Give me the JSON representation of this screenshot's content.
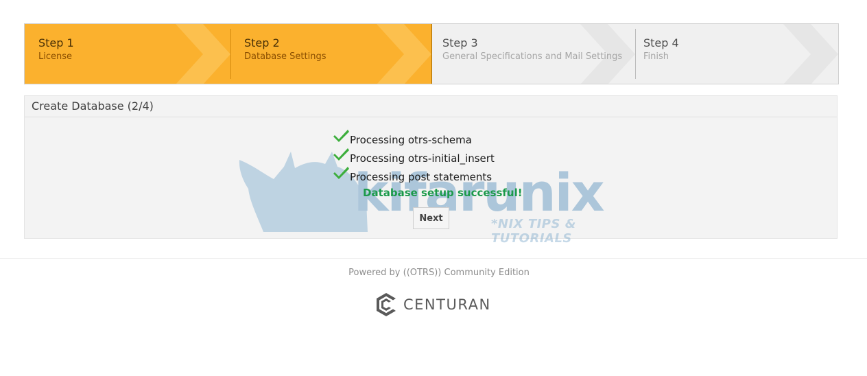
{
  "steps": [
    {
      "title": "Step 1",
      "subtitle": "License",
      "state": "completed"
    },
    {
      "title": "Step 2",
      "subtitle": "Database Settings",
      "state": "active"
    },
    {
      "title": "Step 3",
      "subtitle": "General Specifications and Mail Settings",
      "state": "pending"
    },
    {
      "title": "Step 4",
      "subtitle": "Finish",
      "state": "pending"
    }
  ],
  "panel": {
    "title": "Create Database (2/4)",
    "items": [
      {
        "text": "Processing otrs-schema",
        "icon": "check-icon"
      },
      {
        "text": "Processing otrs-initial_insert",
        "icon": "check-icon"
      },
      {
        "text": "Processing post statements",
        "icon": "check-icon"
      }
    ],
    "success_message": "Database setup successful!",
    "next_label": "Next"
  },
  "watermark": {
    "brand": "kifarunix",
    "tagline": "*NIX TIPS & TUTORIALS"
  },
  "footer": {
    "powered_by": "Powered by ((OTRS)) Community Edition",
    "brand_name": "CENTURAN",
    "brand_icon": "centuran-logo-icon"
  },
  "colors": {
    "active_step": "#fbb12e",
    "inactive_step": "#f0f0f0",
    "success": "#1b9a4a",
    "check": "#3cae3c"
  }
}
